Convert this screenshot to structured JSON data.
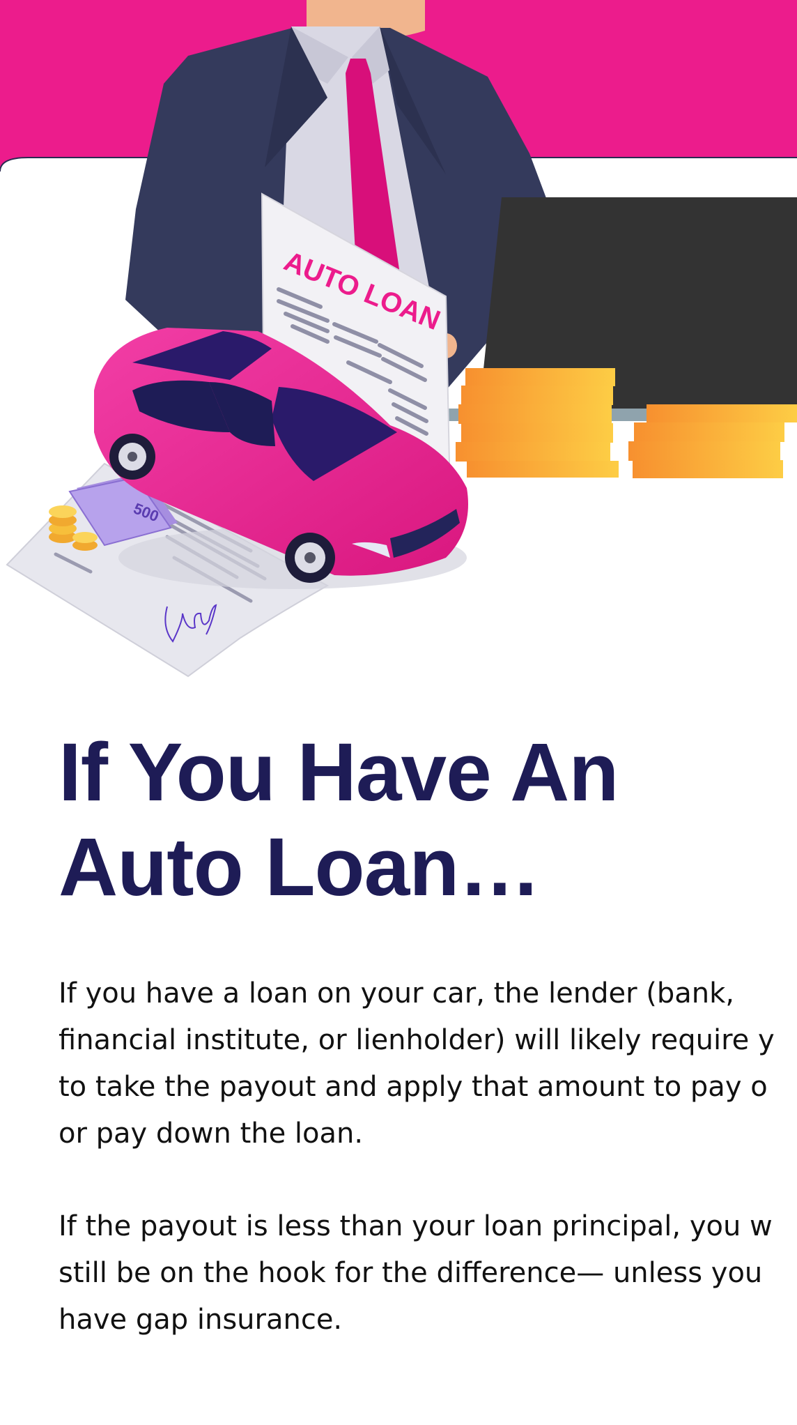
{
  "hero": {
    "document_title": "AUTO LOAN",
    "banknote_denomination": "500",
    "colors": {
      "banner": "#ec1c8c",
      "suit": "#343a5c",
      "tie": "#d80f7a",
      "car": "#ec2a94",
      "laptop": "#333333",
      "coins": "#f7a12c"
    }
  },
  "article": {
    "headline_lines": [
      "If You Have An",
      "Auto Loan…"
    ],
    "paragraph1_lines": [
      "If you have a loan on your car, the lender (bank,",
      "financial institute, or lienholder) will likely require y",
      "to take the payout and apply that amount to pay o",
      "or pay down the loan."
    ],
    "paragraph2_lines": [
      "If the payout is less than your loan principal, you w",
      "still be on the hook for the difference— unless you",
      "have gap insurance."
    ]
  }
}
